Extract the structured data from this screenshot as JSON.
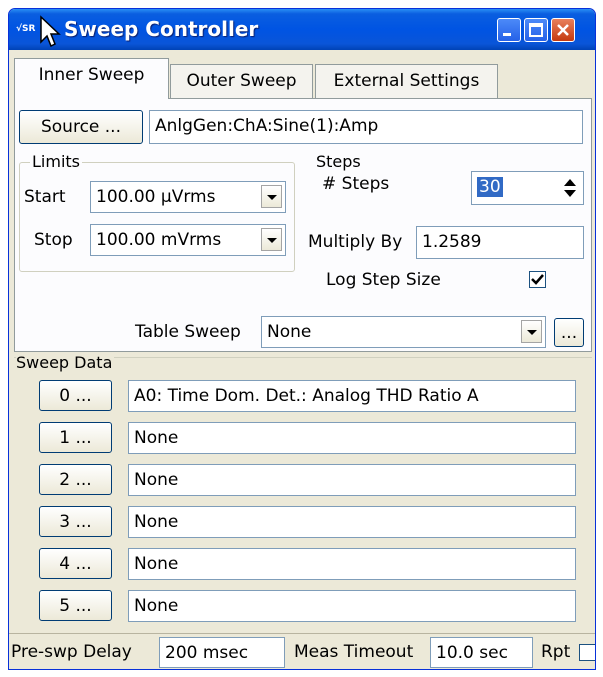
{
  "window": {
    "title": "Sweep Controller",
    "icon_text": "√SR",
    "icon": "srs-app-icon",
    "controls": [
      "minimize-icon",
      "maximize-icon",
      "close-icon"
    ]
  },
  "tabs": [
    {
      "label": "Inner Sweep",
      "active": true
    },
    {
      "label": "Outer Sweep",
      "active": false
    },
    {
      "label": "External Settings",
      "active": false
    }
  ],
  "source": {
    "button_label": "Source ...",
    "value": "AnlgGen:ChA:Sine(1):Amp"
  },
  "limits": {
    "title": "Limits",
    "start_label": "Start",
    "start_value": "100.00 µVrms",
    "stop_label": "Stop",
    "stop_value": "100.00 mVrms"
  },
  "steps": {
    "title": "Steps",
    "steps_label": "# Steps",
    "steps_value": "30",
    "multiply_label": "Multiply By",
    "multiply_value": "1.2589",
    "log_label": "Log Step Size",
    "log_checked": true
  },
  "table_sweep": {
    "label": "Table Sweep",
    "value": "None",
    "browse_label": "..."
  },
  "sweep_data": {
    "title": "Sweep Data",
    "rows": [
      {
        "button": "0 ...",
        "value": "A0: Time Dom. Det.: Analog THD Ratio A"
      },
      {
        "button": "1 ...",
        "value": "None"
      },
      {
        "button": "2 ...",
        "value": "None"
      },
      {
        "button": "3 ...",
        "value": "None"
      },
      {
        "button": "4 ...",
        "value": "None"
      },
      {
        "button": "5 ...",
        "value": "None"
      }
    ]
  },
  "status": {
    "pre_delay_label": "Pre-swp Delay",
    "pre_delay_value": "200 msec",
    "meas_timeout_label": "Meas Timeout",
    "meas_timeout_value": "10.0 sec",
    "rpt_label": "Rpt",
    "rpt_checked": false
  },
  "colors": {
    "titlebar": "#0054e3",
    "window_bg": "#ece9d8",
    "accent": "#316ac5"
  }
}
